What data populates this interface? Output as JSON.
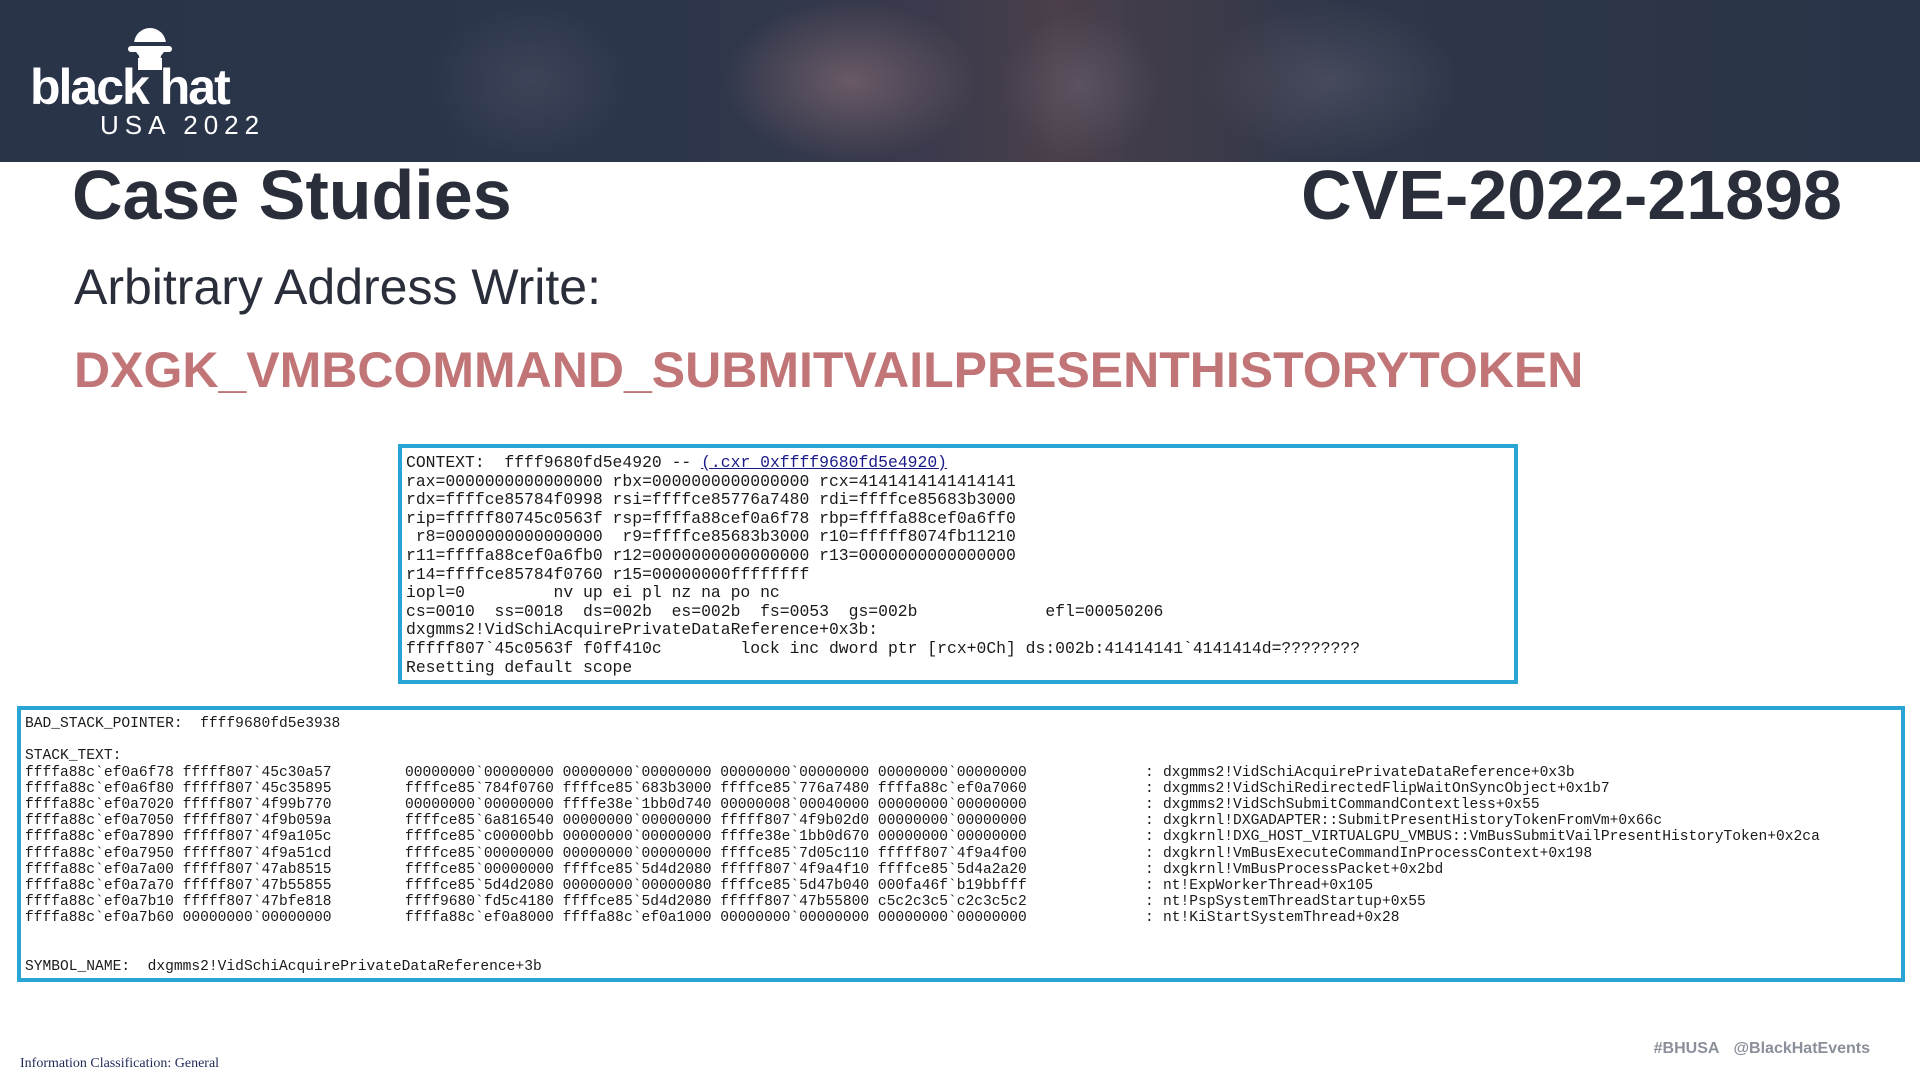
{
  "header": {
    "logo_word": "black hat",
    "logo_sub": "USA 2022"
  },
  "slide": {
    "title": "Case Studies",
    "cve": "CVE-2022-21898",
    "subtitle": "Arbitrary Address Write:",
    "struct_name": "DXGK_VMBCOMMAND_SUBMITVAILPRESENTHISTORYTOKEN"
  },
  "context_box": {
    "context_prefix": "CONTEXT:  ffff9680fd5e4920 -- ",
    "context_link": "(.cxr 0xffff9680fd5e4920)",
    "lines": [
      "rax=0000000000000000 rbx=0000000000000000 rcx=4141414141414141",
      "rdx=ffffce85784f0998 rsi=ffffce85776a7480 rdi=ffffce85683b3000",
      "rip=fffff80745c0563f rsp=ffffa88cef0a6f78 rbp=ffffa88cef0a6ff0",
      " r8=0000000000000000  r9=ffffce85683b3000 r10=fffff8074fb11210",
      "r11=ffffa88cef0a6fb0 r12=0000000000000000 r13=0000000000000000",
      "r14=ffffce85784f0760 r15=00000000ffffffff",
      "iopl=0         nv up ei pl nz na po nc",
      "cs=0010  ss=0018  ds=002b  es=002b  fs=0053  gs=002b             efl=00050206",
      "dxgmms2!VidSchiAcquirePrivateDataReference+0x3b:",
      "fffff807`45c0563f f0ff410c        lock inc dword ptr [rcx+0Ch] ds:002b:41414141`4141414d=????????",
      "Resetting default scope"
    ]
  },
  "stack_box": {
    "bad_stack_pointer": "BAD_STACK_POINTER:  ffff9680fd5e3938",
    "stack_text_label": "STACK_TEXT:",
    "rows": [
      {
        "child": "ffffa88c`ef0a6f78 fffff807`45c30a57",
        "args": "00000000`00000000 00000000`00000000 00000000`00000000 00000000`00000000",
        "site": "dxgmms2!VidSchiAcquirePrivateDataReference+0x3b"
      },
      {
        "child": "ffffa88c`ef0a6f80 fffff807`45c35895",
        "args": "ffffce85`784f0760 ffffce85`683b3000 ffffce85`776a7480 ffffa88c`ef0a7060",
        "site": "dxgmms2!VidSchiRedirectedFlipWaitOnSyncObject+0x1b7"
      },
      {
        "child": "ffffa88c`ef0a7020 fffff807`4f99b770",
        "args": "00000000`00000000 ffffe38e`1bb0d740 00000008`00040000 00000000`00000000",
        "site": "dxgmms2!VidSchSubmitCommandContextless+0x55"
      },
      {
        "child": "ffffa88c`ef0a7050 fffff807`4f9b059a",
        "args": "ffffce85`6a816540 00000000`00000000 fffff807`4f9b02d0 00000000`00000000",
        "site": "dxgkrnl!DXGADAPTER::SubmitPresentHistoryTokenFromVm+0x66c"
      },
      {
        "child": "ffffa88c`ef0a7890 fffff807`4f9a105c",
        "args": "ffffce85`c00000bb 00000000`00000000 ffffe38e`1bb0d670 00000000`00000000",
        "site": "dxgkrnl!DXG_HOST_VIRTUALGPU_VMBUS::VmBusSubmitVailPresentHistoryToken+0x2ca"
      },
      {
        "child": "ffffa88c`ef0a7950 fffff807`4f9a51cd",
        "args": "ffffce85`00000000 00000000`00000000 ffffce85`7d05c110 fffff807`4f9a4f00",
        "site": "dxgkrnl!VmBusExecuteCommandInProcessContext+0x198"
      },
      {
        "child": "ffffa88c`ef0a7a00 fffff807`47ab8515",
        "args": "ffffce85`00000000 ffffce85`5d4d2080 fffff807`4f9a4f10 ffffce85`5d4a2a20",
        "site": "dxgkrnl!VmBusProcessPacket+0x2bd"
      },
      {
        "child": "ffffa88c`ef0a7a70 fffff807`47b55855",
        "args": "ffffce85`5d4d2080 00000000`00000080 ffffce85`5d47b040 000fa46f`b19bbfff",
        "site": "nt!ExpWorkerThread+0x105"
      },
      {
        "child": "ffffa88c`ef0a7b10 fffff807`47bfe818",
        "args": "ffff9680`fd5c4180 ffffce85`5d4d2080 fffff807`47b55800 c5c2c3c5`c2c3c5c2",
        "site": "nt!PspSystemThreadStartup+0x55"
      },
      {
        "child": "ffffa88c`ef0a7b60 00000000`00000000",
        "args": "ffffa88c`ef0a8000 ffffa88c`ef0a1000 00000000`00000000 00000000`00000000",
        "site": "nt!KiStartSystemThread+0x28"
      }
    ],
    "separator": ":",
    "symbol_name": "SYMBOL_NAME:  dxgmms2!VidSchiAcquirePrivateDataReference+3b"
  },
  "footer": {
    "classification": "Information Classification: General",
    "hashtag": "#BHUSA",
    "handle": "@BlackHatEvents"
  },
  "colors": {
    "banner": "#2a3448",
    "title": "#2a2e3a",
    "struct_name": "#c17577",
    "box_border": "#2aa4d4",
    "footer_grey": "#8a8f9a"
  }
}
